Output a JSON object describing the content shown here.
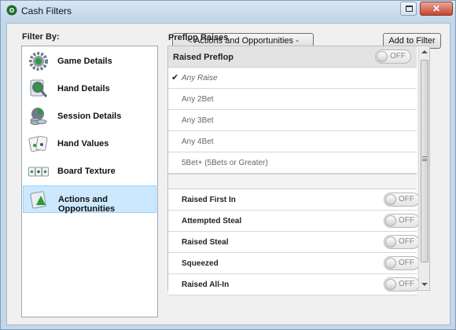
{
  "window": {
    "title": "Cash Filters",
    "close_glyph": "✕",
    "accent_color": "#cce8ff"
  },
  "sidebar": {
    "heading": "Filter By:",
    "items": [
      {
        "label": "Game Details",
        "icon": "gear-icon"
      },
      {
        "label": "Hand Details",
        "icon": "magnifier-icon"
      },
      {
        "label": "Session Details",
        "icon": "chips-icon"
      },
      {
        "label": "Hand Values",
        "icon": "cards-icon"
      },
      {
        "label": "Board Texture",
        "icon": "board-cards-icon"
      },
      {
        "label": "Actions and Opportunities",
        "icon": "actions-icon",
        "selected": true
      }
    ]
  },
  "toolbar": {
    "back_label": "< Actions and Opportunities - Preflop",
    "add_label": "Add to Filter"
  },
  "main": {
    "section_title": "Preflop Raises",
    "group": {
      "label": "Raised Preflop",
      "toggle": "OFF",
      "options": [
        {
          "label": "Any Raise",
          "checked": true
        },
        {
          "label": "Any 2Bet",
          "checked": false
        },
        {
          "label": "Any 3Bet",
          "checked": false
        },
        {
          "label": "Any 4Bet",
          "checked": false
        },
        {
          "label": "5Bet+ (5Bets or Greater)",
          "checked": false
        }
      ]
    },
    "check_glyph": "✔",
    "toggles": [
      {
        "label": "Raised First In",
        "state": "OFF"
      },
      {
        "label": "Attempted Steal",
        "state": "OFF"
      },
      {
        "label": "Raised Steal",
        "state": "OFF"
      },
      {
        "label": "Squeezed",
        "state": "OFF"
      },
      {
        "label": "Raised All-In",
        "state": "OFF"
      }
    ]
  }
}
